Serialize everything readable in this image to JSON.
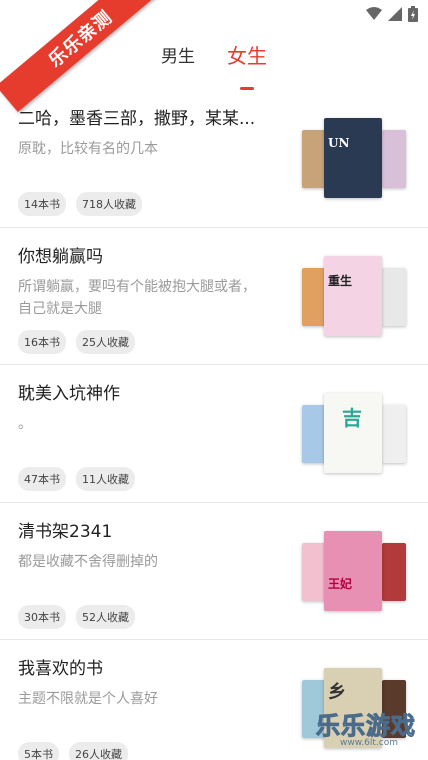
{
  "ribbon": {
    "label": "乐乐亲测"
  },
  "tabs": [
    {
      "label": "男生",
      "active": false
    },
    {
      "label": "女生",
      "active": true
    }
  ],
  "lists": [
    {
      "title": "二哈，墨香三部，撒野，某某...",
      "desc": "原耽，比较有名的几本",
      "books": "14本书",
      "favorites": "718人收藏",
      "cover_colors": [
        "#c8a37a",
        "#2b3a53",
        "#d8c0d8"
      ],
      "cover_text": "UN"
    },
    {
      "title": "你想躺赢吗",
      "desc": "所谓躺赢，要吗有个能被抱大腿或者，自己就是大腿",
      "books": "16本书",
      "favorites": "25人收藏",
      "cover_colors": [
        "#e0a060",
        "#f4d4e4",
        "#e8e8e8"
      ],
      "cover_text": "重生"
    },
    {
      "title": "耽美入坑神作",
      "desc": "。",
      "books": "47本书",
      "favorites": "11人收藏",
      "cover_colors": [
        "#a7c8e6",
        "#f7f7f4",
        "#efefef"
      ],
      "cover_text": "吉"
    },
    {
      "title": "清书架2341",
      "desc": "都是收藏不舍得删掉的",
      "books": "30本书",
      "favorites": "52人收藏",
      "cover_colors": [
        "#f3c0d0",
        "#e88fb4",
        "#b33a3a"
      ],
      "cover_text": "王妃"
    },
    {
      "title": "我喜欢的书",
      "desc": "主题不限就是个人喜好",
      "books": "5本书",
      "favorites": "26人收藏",
      "cover_colors": [
        "#9fc9d9",
        "#d9d0b4",
        "#5a3a2a"
      ],
      "cover_text": "乡"
    }
  ],
  "watermark": {
    "text": "乐乐游戏",
    "url": "www.6lt.com"
  }
}
